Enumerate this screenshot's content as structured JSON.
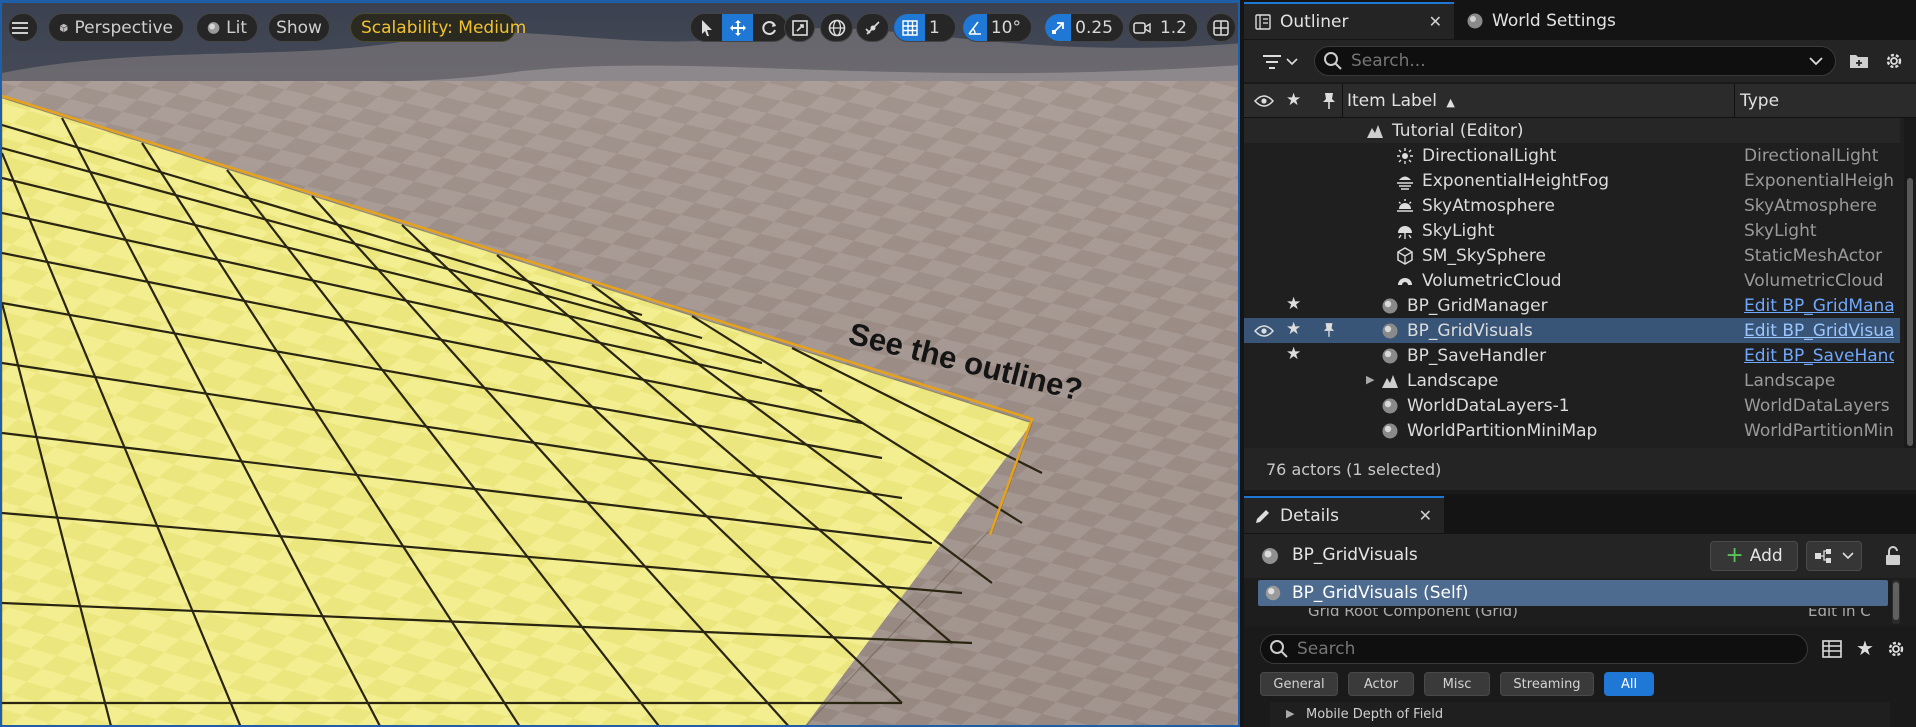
{
  "viewport": {
    "perspective_label": "Perspective",
    "lit_label": "Lit",
    "show_label": "Show",
    "scalability_label": "Scalability: Medium",
    "grid_snap_value": "1",
    "rotation_snap_value": "10°",
    "scale_snap_value": "0.25",
    "camera_speed_value": "1.2",
    "annotation_text": "See the outline?",
    "colors": {
      "grid_fill": "#e8e27a",
      "outline": "#e8a21a",
      "accent": "#1f77d6"
    }
  },
  "outliner": {
    "tab_label": "Outliner",
    "world_settings_tab_label": "World Settings",
    "search_placeholder": "Search...",
    "col_item_label": "Item Label",
    "col_type": "Type",
    "level_label": "Tutorial (Editor)",
    "rows": [
      {
        "label": "DirectionalLight",
        "type": "DirectionalLight",
        "icon": "directional-light-icon"
      },
      {
        "label": "ExponentialHeightFog",
        "type": "ExponentialHeightF",
        "icon": "fog-icon"
      },
      {
        "label": "SkyAtmosphere",
        "type": "SkyAtmosphere",
        "icon": "sky-atmosphere-icon"
      },
      {
        "label": "SkyLight",
        "type": "SkyLight",
        "icon": "skylight-icon"
      },
      {
        "label": "SM_SkySphere",
        "type": "StaticMeshActor",
        "icon": "static-mesh-icon"
      },
      {
        "label": "VolumetricCloud",
        "type": "VolumetricCloud",
        "icon": "cloud-icon"
      },
      {
        "label": "BP_GridManager",
        "type": "Edit BP_GridManag",
        "icon": "actor-icon"
      },
      {
        "label": "BP_GridVisuals",
        "type": "Edit BP_GridVisuals",
        "icon": "actor-icon"
      },
      {
        "label": "BP_SaveHandler",
        "type": "Edit BP_SaveHandl",
        "icon": "actor-icon"
      },
      {
        "label": "Landscape",
        "type": "Landscape",
        "icon": "landscape-icon"
      },
      {
        "label": "WorldDataLayers-1",
        "type": "WorldDataLayers",
        "icon": "actor-icon"
      },
      {
        "label": "WorldPartitionMiniMap",
        "type": "WorldPartitionMini",
        "icon": "actor-icon"
      }
    ],
    "status": "76 actors (1 selected)"
  },
  "details": {
    "tab_label": "Details",
    "object_name": "BP_GridVisuals",
    "add_label": "Add",
    "component_self": "BP_GridVisuals (Self)",
    "component_next": "Grid Root Component (Grid)",
    "component_next_type": "Edit in C",
    "search_placeholder": "Search",
    "filters": [
      "General",
      "Actor",
      "Misc",
      "Streaming",
      "All"
    ],
    "property_row": "Mobile Depth of Field"
  }
}
